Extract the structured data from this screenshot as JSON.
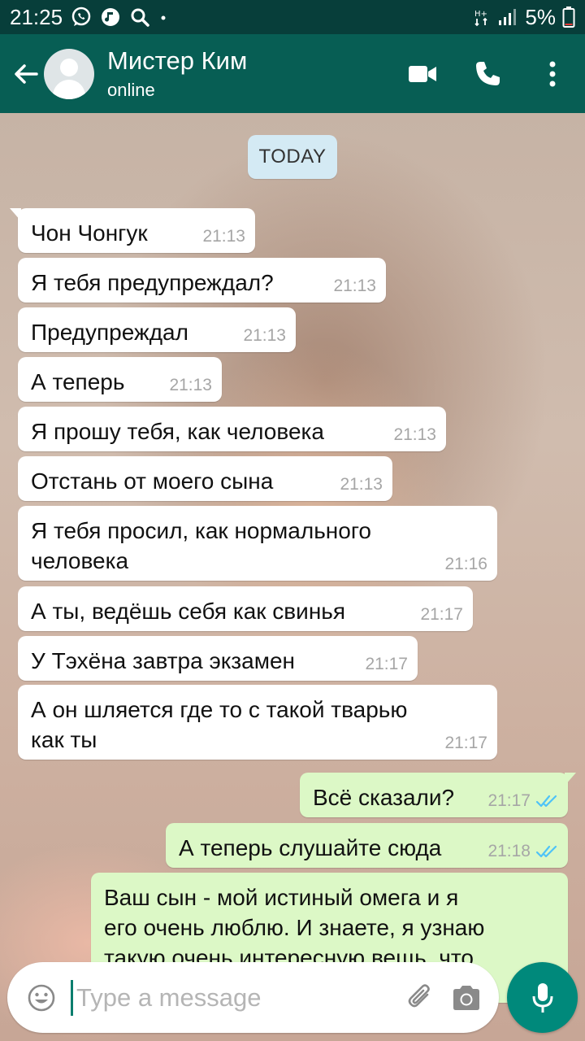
{
  "status_bar": {
    "time": "21:25",
    "battery": "5%"
  },
  "header": {
    "contact_name": "Мистер Ким",
    "status": "online"
  },
  "chat": {
    "date_label": "TODAY",
    "messages": [
      {
        "dir": "in",
        "lines": [
          "Чон Чонгук"
        ],
        "time": "21:13"
      },
      {
        "dir": "in",
        "lines": [
          "Я тебя предупреждал?"
        ],
        "time": "21:13"
      },
      {
        "dir": "in",
        "lines": [
          "Предупреждал"
        ],
        "time": "21:13"
      },
      {
        "dir": "in",
        "lines": [
          "А теперь"
        ],
        "time": "21:13"
      },
      {
        "dir": "in",
        "lines": [
          "Я прошу тебя, как человека"
        ],
        "time": "21:13"
      },
      {
        "dir": "in",
        "lines": [
          "Отстань от моего сына"
        ],
        "time": "21:13"
      },
      {
        "dir": "in",
        "lines": [
          "Я тебя просил, как нормального",
          "человека"
        ],
        "time": "21:16"
      },
      {
        "dir": "in",
        "lines": [
          "А ты, ведёшь себя как свинья"
        ],
        "time": "21:17"
      },
      {
        "dir": "in",
        "lines": [
          "У Тэхёна завтра экзамен"
        ],
        "time": "21:17"
      },
      {
        "dir": "in",
        "lines": [
          "А он шляется где то с такой тварью",
          "как ты"
        ],
        "time": "21:17"
      },
      {
        "dir": "out",
        "lines": [
          "Всё сказали?"
        ],
        "time": "21:17"
      },
      {
        "dir": "out",
        "lines": [
          "А теперь слушайте сюда"
        ],
        "time": "21:18"
      },
      {
        "dir": "out",
        "lines": [
          "Ваш сын - мой истиный омега и я",
          "его очень люблю. И знаете, я узнаю",
          "такую очень интересную вещь, что"
        ],
        "time": ""
      }
    ]
  },
  "input": {
    "placeholder": "Type a message"
  },
  "colors": {
    "header": "#075e54",
    "status_bar": "#073e3a",
    "incoming": "#ffffff",
    "outgoing": "#dcf8c6",
    "read_ticks": "#4fc3f7",
    "mic": "#00897b"
  },
  "icons": [
    "whatsapp-icon",
    "music-icon",
    "search-icon",
    "back-arrow-icon",
    "video-call-icon",
    "phone-icon",
    "more-vert-icon",
    "emoji-icon",
    "attach-icon",
    "camera-icon",
    "mic-icon"
  ]
}
